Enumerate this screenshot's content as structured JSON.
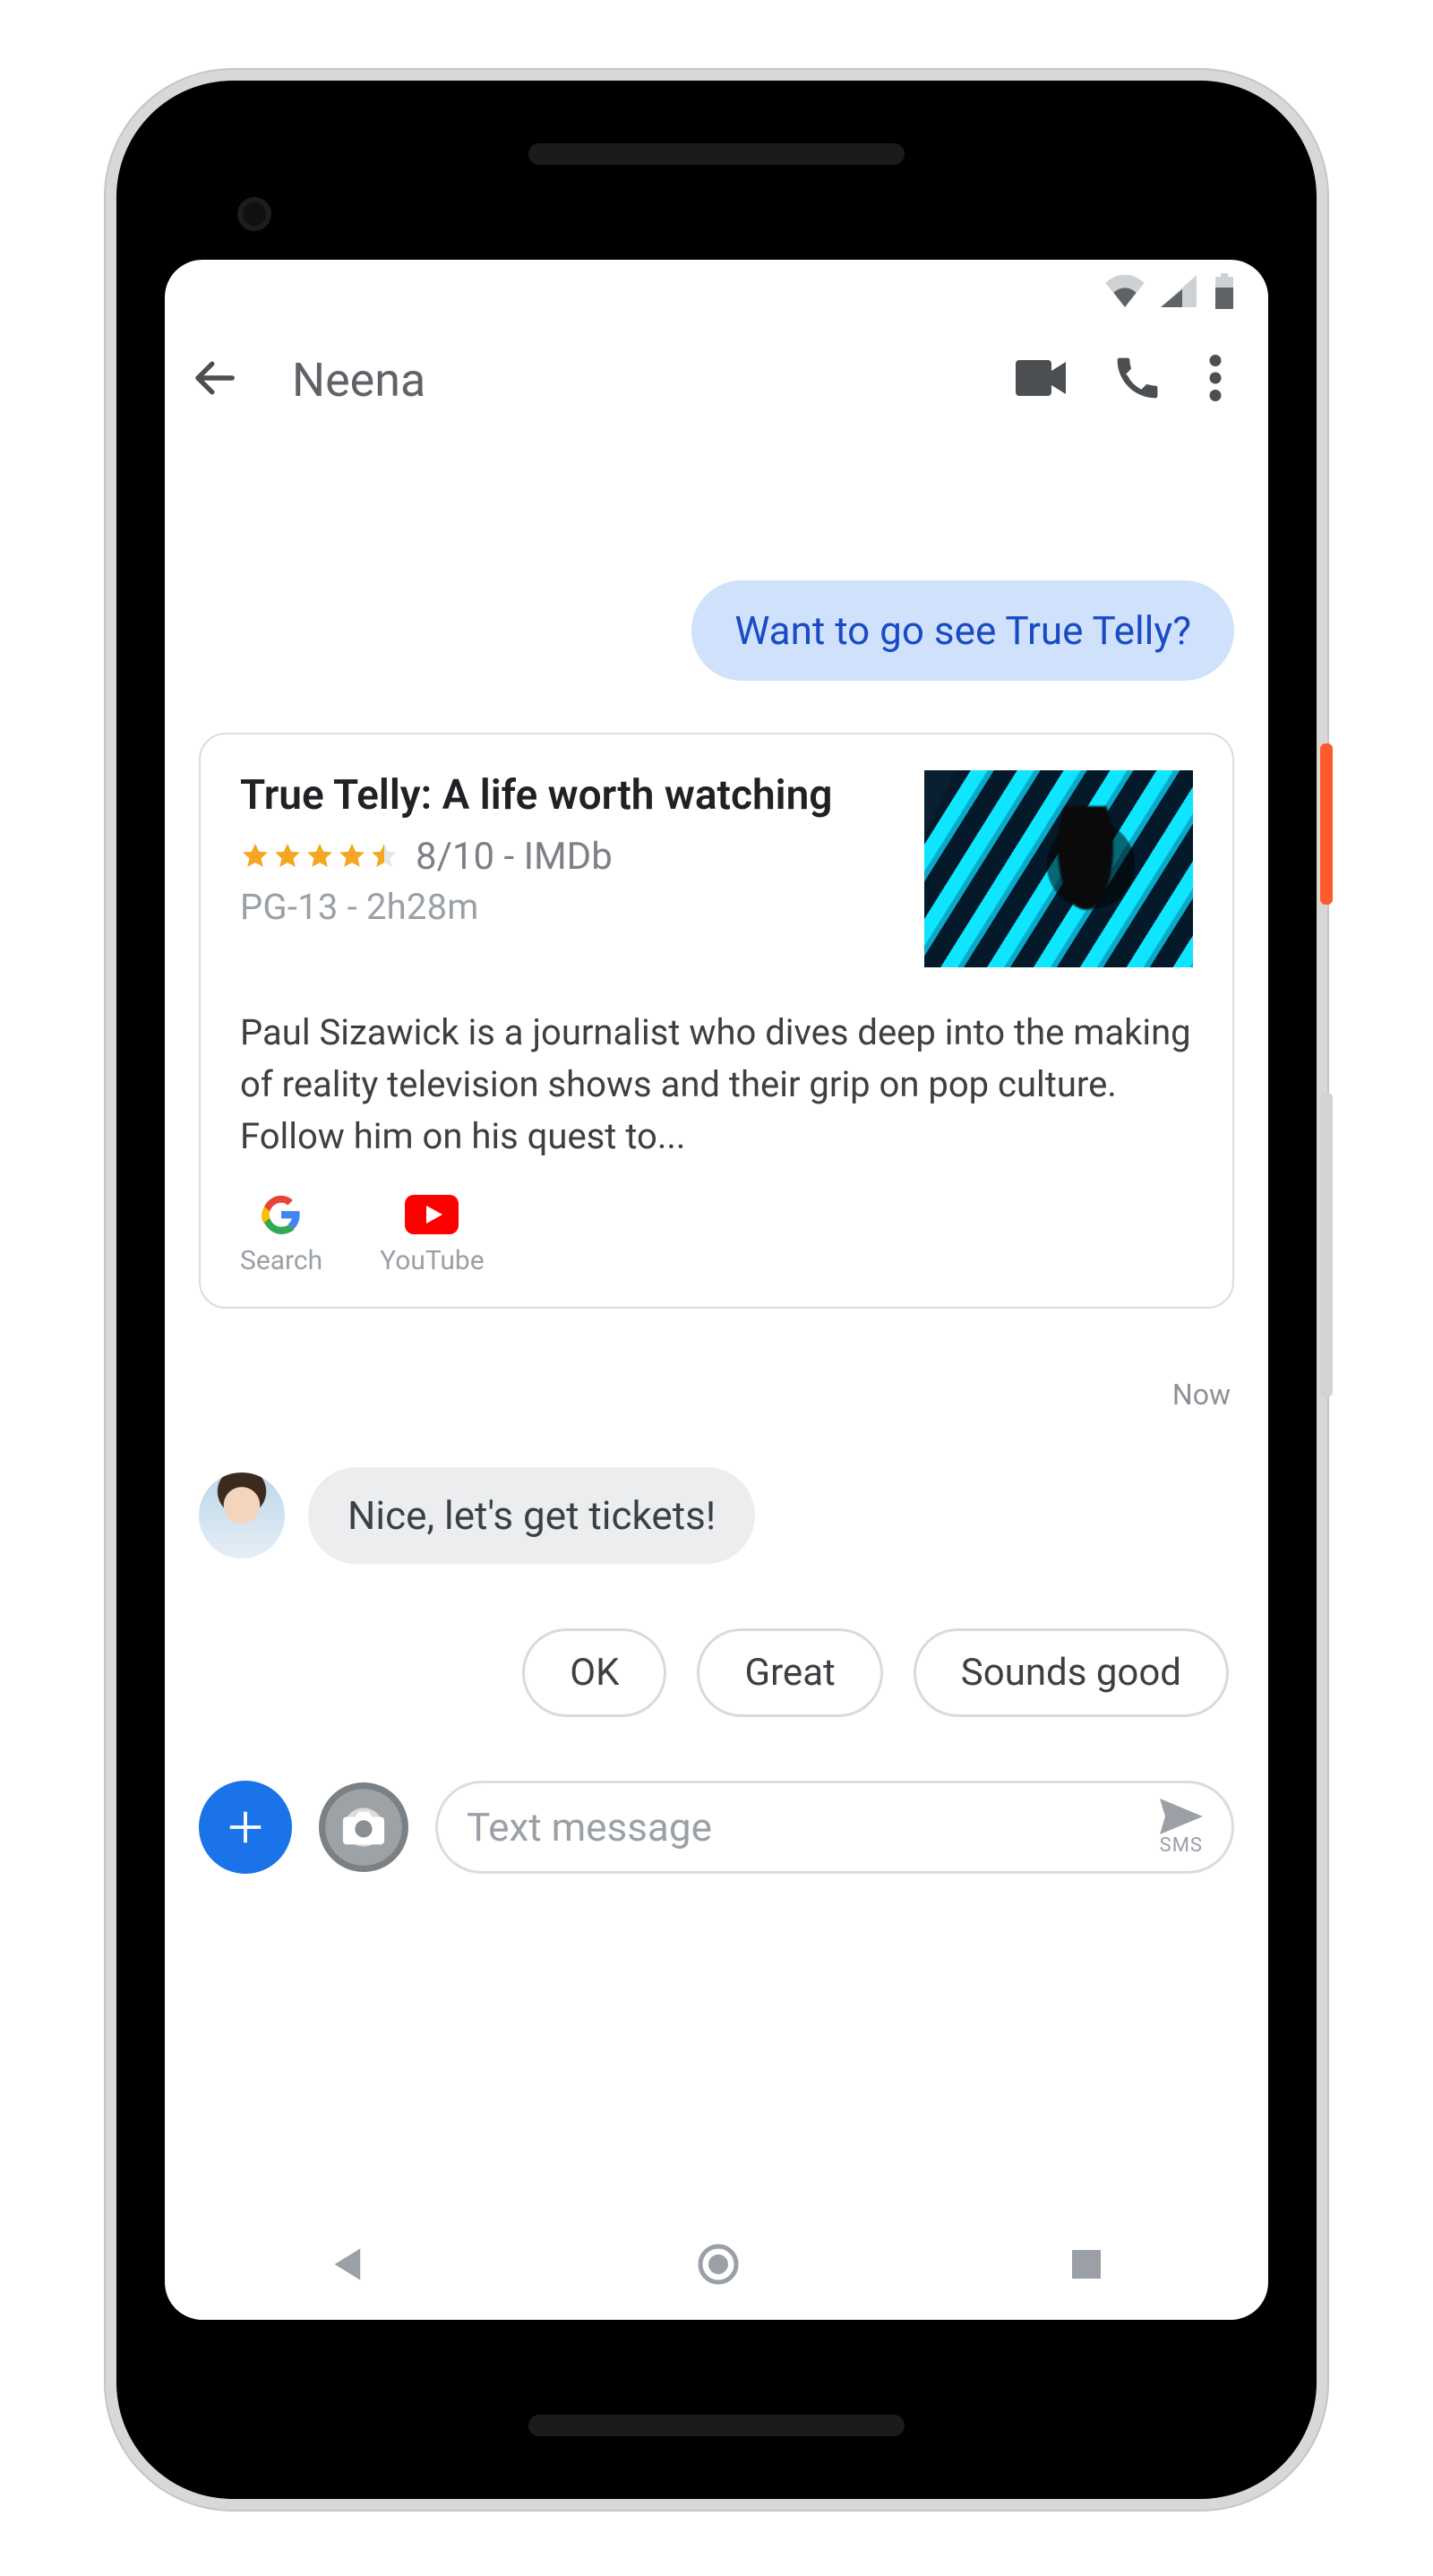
{
  "header": {
    "contact_name": "Neena"
  },
  "messages": {
    "outgoing_1": "Want to go see True Telly?",
    "incoming_1": "Nice, let's get tickets!"
  },
  "card": {
    "title": "True Telly: A life worth watching",
    "rating_text": "8/10 - IMDb",
    "star_value": 4.5,
    "meta": "PG-13 - 2h28m",
    "description": "Paul Sizawick is a journalist who dives deep into the making of reality television shows and their grip on pop culture. Follow him on his quest to...",
    "links": {
      "search": "Search",
      "youtube": "YouTube"
    },
    "timestamp": "Now"
  },
  "smart_replies": [
    "OK",
    "Great",
    "Sounds good"
  ],
  "compose": {
    "placeholder": "Text message",
    "send_label": "SMS"
  }
}
